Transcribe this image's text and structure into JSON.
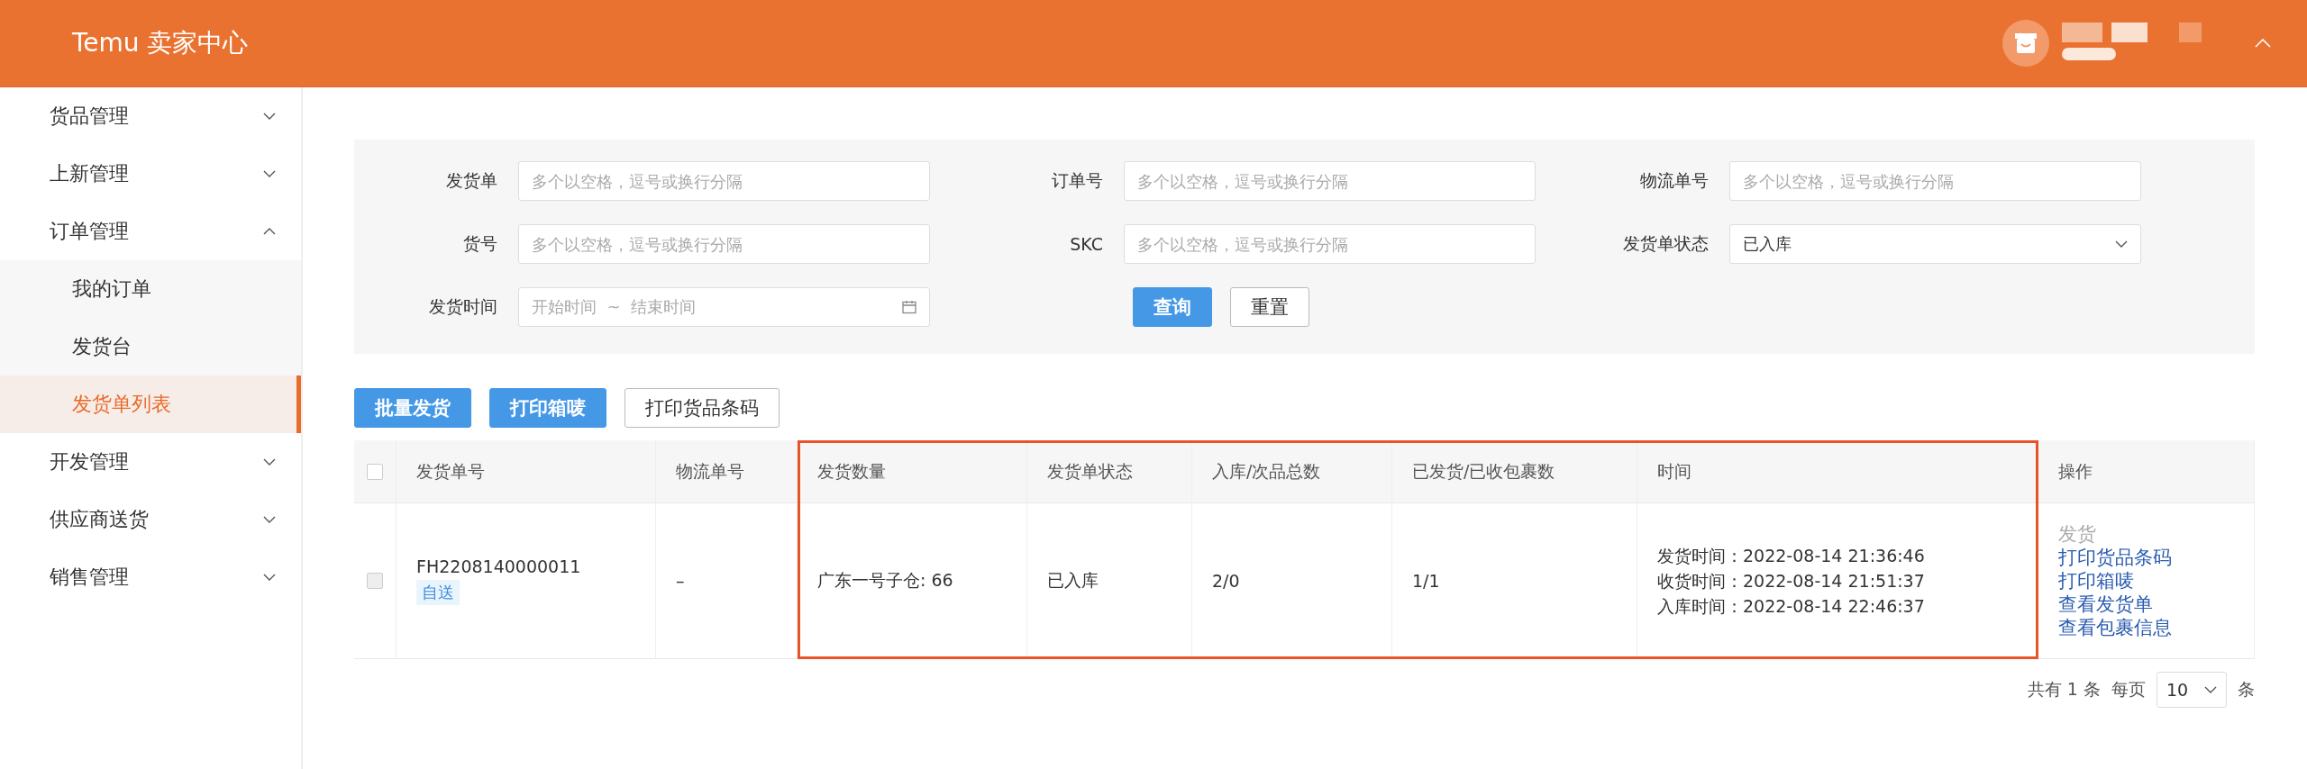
{
  "header": {
    "brand": "Temu 卖家中心"
  },
  "sidebar": {
    "items": [
      {
        "label": "货品管理",
        "expanded": false
      },
      {
        "label": "上新管理",
        "expanded": false
      },
      {
        "label": "订单管理",
        "expanded": true,
        "children": [
          {
            "label": "我的订单",
            "selected": false
          },
          {
            "label": "发货台",
            "selected": false
          },
          {
            "label": "发货单列表",
            "selected": true
          }
        ]
      },
      {
        "label": "开发管理",
        "expanded": false
      },
      {
        "label": "供应商送货",
        "expanded": false
      },
      {
        "label": "销售管理",
        "expanded": false
      }
    ]
  },
  "filters": [
    {
      "kind": "text",
      "label": "发货单",
      "placeholder": "多个以空格，逗号或换行分隔"
    },
    {
      "kind": "text",
      "label": "订单号",
      "placeholder": "多个以空格，逗号或换行分隔"
    },
    {
      "kind": "text",
      "label": "物流单号",
      "placeholder": "多个以空格，逗号或换行分隔"
    },
    {
      "kind": "text",
      "label": "货号",
      "placeholder": "多个以空格，逗号或换行分隔"
    },
    {
      "kind": "text",
      "label": "SKC",
      "placeholder": "多个以空格，逗号或换行分隔"
    },
    {
      "kind": "select",
      "label": "发货单状态",
      "value": "已入库"
    },
    {
      "kind": "daterange",
      "label": "发货时间",
      "start_placeholder": "开始时间",
      "separator": "~",
      "end_placeholder": "结束时间"
    }
  ],
  "filter_buttons": [
    {
      "label": "查询",
      "kind": "primary"
    },
    {
      "label": "重置",
      "kind": "default"
    }
  ],
  "toolbar": [
    {
      "label": "批量发货",
      "kind": "primary"
    },
    {
      "label": "打印箱唛",
      "kind": "primary"
    },
    {
      "label": "打印货品条码",
      "kind": "default"
    }
  ],
  "table": {
    "columns": [
      {
        "label": "发货单号",
        "highlighted": false
      },
      {
        "label": "物流单号",
        "highlighted": false
      },
      {
        "label": "发货数量",
        "highlighted": true
      },
      {
        "label": "发货单状态",
        "highlighted": true
      },
      {
        "label": "入库/次品总数",
        "highlighted": true
      },
      {
        "label": "已发货/已收包裹数",
        "highlighted": true
      },
      {
        "label": "时间",
        "highlighted": true
      },
      {
        "label": "操作",
        "highlighted": false
      }
    ],
    "header_checked": false,
    "rows": [
      {
        "checked": false,
        "order_no": "FH2208140000011",
        "tag": "自送",
        "logistics_no": "–",
        "quantity": "广东一号子仓: 66",
        "status": "已入库",
        "stock_defect": "2/0",
        "packages": "1/1",
        "times": [
          "发货时间：2022-08-14 21:36:46",
          "收货时间：2022-08-14 21:51:37",
          "入库时间：2022-08-14 22:46:37"
        ],
        "actions": [
          {
            "label": "发货",
            "disabled": true
          },
          {
            "label": "打印货品条码",
            "disabled": false
          },
          {
            "label": "打印箱唛",
            "disabled": false
          },
          {
            "label": "查看发货单",
            "disabled": false
          },
          {
            "label": "查看包裹信息",
            "disabled": false
          }
        ]
      }
    ]
  },
  "pagination": {
    "total": "共有 1 条",
    "per_page_label": "每页",
    "page_size": "10",
    "unit": "条"
  }
}
